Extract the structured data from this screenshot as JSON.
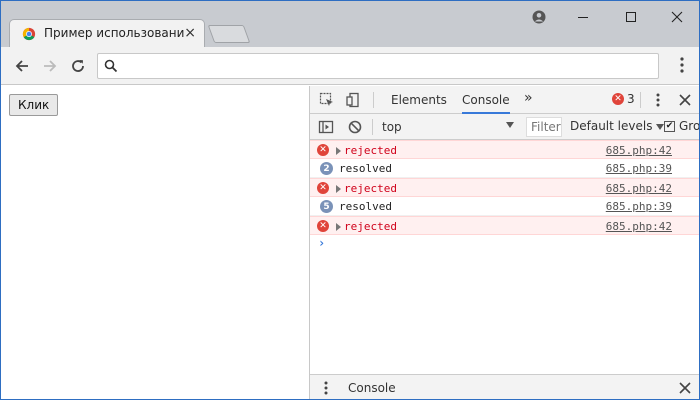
{
  "browser": {
    "tab_title": "Пример использования",
    "tab_close": "×",
    "address_value": "",
    "icons": {
      "favicon": "chrome-favicon",
      "back": "arrow-left-icon",
      "forward": "arrow-right-icon",
      "reload": "reload-icon",
      "search": "search-icon",
      "menu": "vertical-dots-icon",
      "profile": "profile-icon"
    }
  },
  "page": {
    "button_label": "Клик"
  },
  "devtools": {
    "tabs": [
      "Elements",
      "Console"
    ],
    "active_tab": "Console",
    "more_tabs": "»",
    "error_count": "3",
    "error_symbol": "✕",
    "close": "✕",
    "filter": {
      "context": "top",
      "filter_placeholder": "Filter",
      "levels": "Default levels",
      "group_label": "Gro"
    },
    "messages": [
      {
        "type": "error",
        "text": "rejected",
        "source": "685.php:42"
      },
      {
        "type": "log",
        "count": "2",
        "text": "resolved",
        "source": "685.php:39"
      },
      {
        "type": "error",
        "text": "rejected",
        "source": "685.php:42"
      },
      {
        "type": "log",
        "count": "5",
        "text": "resolved",
        "source": "685.php:39"
      },
      {
        "type": "error",
        "text": "rejected",
        "source": "685.php:42"
      }
    ],
    "prompt": "›",
    "drawer_tab": "Console",
    "colors": {
      "error_bg": "#fff0f0",
      "error_text": "#d0021b",
      "accent": "#3879d9",
      "error_badge": "#e0443a",
      "count_badge": "#7a92b8"
    }
  }
}
